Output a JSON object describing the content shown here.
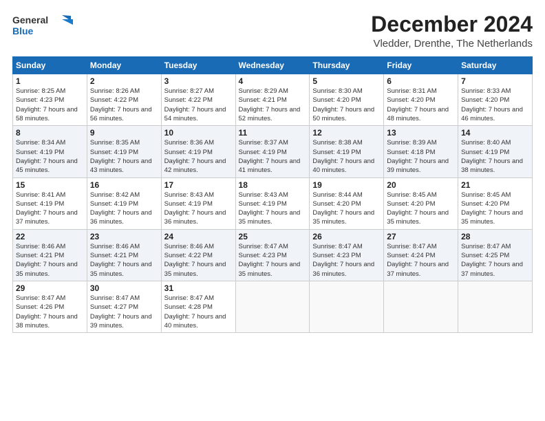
{
  "logo": {
    "line1": "General",
    "line2": "Blue"
  },
  "header": {
    "month": "December 2024",
    "location": "Vledder, Drenthe, The Netherlands"
  },
  "weekdays": [
    "Sunday",
    "Monday",
    "Tuesday",
    "Wednesday",
    "Thursday",
    "Friday",
    "Saturday"
  ],
  "weeks": [
    [
      {
        "day": "1",
        "sunrise": "Sunrise: 8:25 AM",
        "sunset": "Sunset: 4:23 PM",
        "daylight": "Daylight: 7 hours and 58 minutes."
      },
      {
        "day": "2",
        "sunrise": "Sunrise: 8:26 AM",
        "sunset": "Sunset: 4:22 PM",
        "daylight": "Daylight: 7 hours and 56 minutes."
      },
      {
        "day": "3",
        "sunrise": "Sunrise: 8:27 AM",
        "sunset": "Sunset: 4:22 PM",
        "daylight": "Daylight: 7 hours and 54 minutes."
      },
      {
        "day": "4",
        "sunrise": "Sunrise: 8:29 AM",
        "sunset": "Sunset: 4:21 PM",
        "daylight": "Daylight: 7 hours and 52 minutes."
      },
      {
        "day": "5",
        "sunrise": "Sunrise: 8:30 AM",
        "sunset": "Sunset: 4:20 PM",
        "daylight": "Daylight: 7 hours and 50 minutes."
      },
      {
        "day": "6",
        "sunrise": "Sunrise: 8:31 AM",
        "sunset": "Sunset: 4:20 PM",
        "daylight": "Daylight: 7 hours and 48 minutes."
      },
      {
        "day": "7",
        "sunrise": "Sunrise: 8:33 AM",
        "sunset": "Sunset: 4:20 PM",
        "daylight": "Daylight: 7 hours and 46 minutes."
      }
    ],
    [
      {
        "day": "8",
        "sunrise": "Sunrise: 8:34 AM",
        "sunset": "Sunset: 4:19 PM",
        "daylight": "Daylight: 7 hours and 45 minutes."
      },
      {
        "day": "9",
        "sunrise": "Sunrise: 8:35 AM",
        "sunset": "Sunset: 4:19 PM",
        "daylight": "Daylight: 7 hours and 43 minutes."
      },
      {
        "day": "10",
        "sunrise": "Sunrise: 8:36 AM",
        "sunset": "Sunset: 4:19 PM",
        "daylight": "Daylight: 7 hours and 42 minutes."
      },
      {
        "day": "11",
        "sunrise": "Sunrise: 8:37 AM",
        "sunset": "Sunset: 4:19 PM",
        "daylight": "Daylight: 7 hours and 41 minutes."
      },
      {
        "day": "12",
        "sunrise": "Sunrise: 8:38 AM",
        "sunset": "Sunset: 4:19 PM",
        "daylight": "Daylight: 7 hours and 40 minutes."
      },
      {
        "day": "13",
        "sunrise": "Sunrise: 8:39 AM",
        "sunset": "Sunset: 4:18 PM",
        "daylight": "Daylight: 7 hours and 39 minutes."
      },
      {
        "day": "14",
        "sunrise": "Sunrise: 8:40 AM",
        "sunset": "Sunset: 4:19 PM",
        "daylight": "Daylight: 7 hours and 38 minutes."
      }
    ],
    [
      {
        "day": "15",
        "sunrise": "Sunrise: 8:41 AM",
        "sunset": "Sunset: 4:19 PM",
        "daylight": "Daylight: 7 hours and 37 minutes."
      },
      {
        "day": "16",
        "sunrise": "Sunrise: 8:42 AM",
        "sunset": "Sunset: 4:19 PM",
        "daylight": "Daylight: 7 hours and 36 minutes."
      },
      {
        "day": "17",
        "sunrise": "Sunrise: 8:43 AM",
        "sunset": "Sunset: 4:19 PM",
        "daylight": "Daylight: 7 hours and 36 minutes."
      },
      {
        "day": "18",
        "sunrise": "Sunrise: 8:43 AM",
        "sunset": "Sunset: 4:19 PM",
        "daylight": "Daylight: 7 hours and 35 minutes."
      },
      {
        "day": "19",
        "sunrise": "Sunrise: 8:44 AM",
        "sunset": "Sunset: 4:20 PM",
        "daylight": "Daylight: 7 hours and 35 minutes."
      },
      {
        "day": "20",
        "sunrise": "Sunrise: 8:45 AM",
        "sunset": "Sunset: 4:20 PM",
        "daylight": "Daylight: 7 hours and 35 minutes."
      },
      {
        "day": "21",
        "sunrise": "Sunrise: 8:45 AM",
        "sunset": "Sunset: 4:20 PM",
        "daylight": "Daylight: 7 hours and 35 minutes."
      }
    ],
    [
      {
        "day": "22",
        "sunrise": "Sunrise: 8:46 AM",
        "sunset": "Sunset: 4:21 PM",
        "daylight": "Daylight: 7 hours and 35 minutes."
      },
      {
        "day": "23",
        "sunrise": "Sunrise: 8:46 AM",
        "sunset": "Sunset: 4:21 PM",
        "daylight": "Daylight: 7 hours and 35 minutes."
      },
      {
        "day": "24",
        "sunrise": "Sunrise: 8:46 AM",
        "sunset": "Sunset: 4:22 PM",
        "daylight": "Daylight: 7 hours and 35 minutes."
      },
      {
        "day": "25",
        "sunrise": "Sunrise: 8:47 AM",
        "sunset": "Sunset: 4:23 PM",
        "daylight": "Daylight: 7 hours and 35 minutes."
      },
      {
        "day": "26",
        "sunrise": "Sunrise: 8:47 AM",
        "sunset": "Sunset: 4:23 PM",
        "daylight": "Daylight: 7 hours and 36 minutes."
      },
      {
        "day": "27",
        "sunrise": "Sunrise: 8:47 AM",
        "sunset": "Sunset: 4:24 PM",
        "daylight": "Daylight: 7 hours and 37 minutes."
      },
      {
        "day": "28",
        "sunrise": "Sunrise: 8:47 AM",
        "sunset": "Sunset: 4:25 PM",
        "daylight": "Daylight: 7 hours and 37 minutes."
      }
    ],
    [
      {
        "day": "29",
        "sunrise": "Sunrise: 8:47 AM",
        "sunset": "Sunset: 4:26 PM",
        "daylight": "Daylight: 7 hours and 38 minutes."
      },
      {
        "day": "30",
        "sunrise": "Sunrise: 8:47 AM",
        "sunset": "Sunset: 4:27 PM",
        "daylight": "Daylight: 7 hours and 39 minutes."
      },
      {
        "day": "31",
        "sunrise": "Sunrise: 8:47 AM",
        "sunset": "Sunset: 4:28 PM",
        "daylight": "Daylight: 7 hours and 40 minutes."
      },
      null,
      null,
      null,
      null
    ]
  ]
}
